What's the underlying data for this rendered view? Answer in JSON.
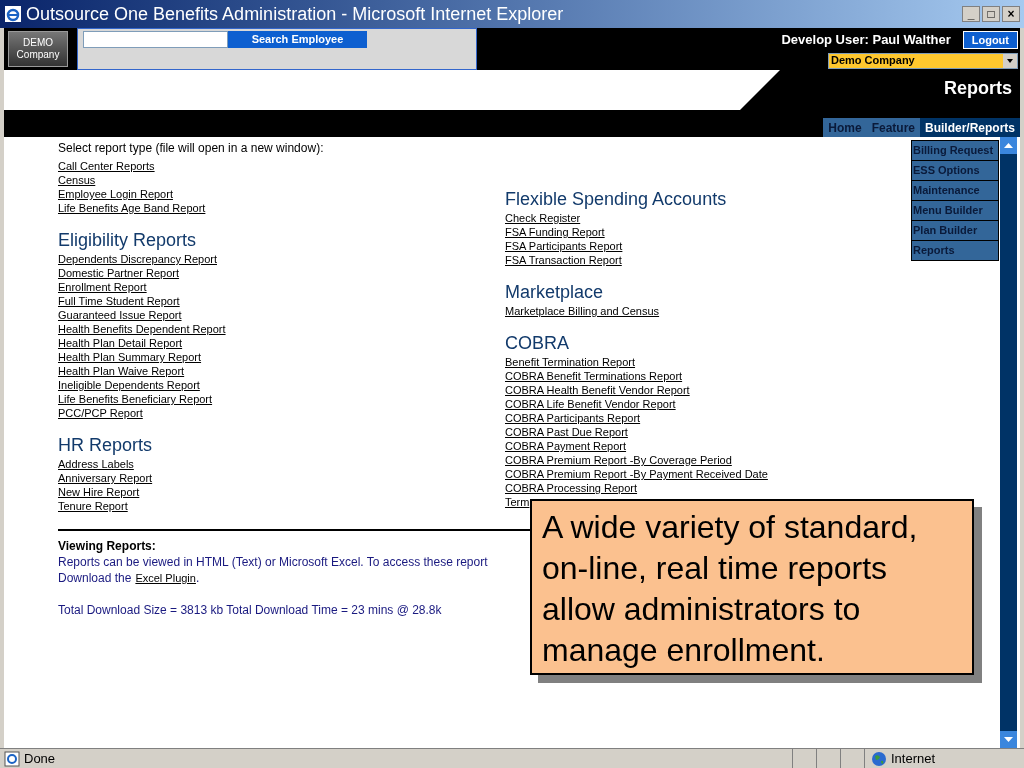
{
  "window": {
    "title": "Outsource One Benefits Administration - Microsoft Internet Explorer",
    "controls": [
      "_",
      "□",
      "×"
    ]
  },
  "header": {
    "logo": [
      "DEMO",
      "Company"
    ],
    "search_button": "Search Employee",
    "user": "Develop User: Paul Walther",
    "logout": "Logout",
    "company_select": "Demo Company",
    "page_title": "Reports"
  },
  "nav": {
    "tabs": [
      {
        "label": "Home",
        "selected": false
      },
      {
        "label": "Feature",
        "selected": false
      },
      {
        "label": "Builder/Reports",
        "selected": true
      }
    ],
    "menu": [
      "Billing Request",
      "ESS Options",
      "Maintenance",
      "Menu Builder",
      "Plan Builder",
      "Reports"
    ]
  },
  "intro": "Select report type (file will open in a new window):",
  "left_sections": [
    {
      "links": [
        "Call Center Reports",
        "Census",
        "Employee Login Report",
        "Life Benefits Age Band Report"
      ]
    },
    {
      "heading": "Eligibility Reports",
      "links": [
        "Dependents Discrepancy Report",
        "Domestic Partner Report",
        "Enrollment Report",
        "Full Time Student Report",
        "Guaranteed Issue Report",
        "Health Benefits Dependent Report",
        "Health Plan Detail Report",
        "Health Plan Summary Report",
        "Health Plan Waive Report",
        "Ineligible Dependents Report",
        "Life Benefits Beneficiary Report",
        "PCC/PCP Report"
      ]
    },
    {
      "heading": "HR Reports",
      "links": [
        "Address Labels",
        "Anniversary Report",
        "New Hire Report",
        "Tenure Report"
      ]
    }
  ],
  "right_sections": [
    {
      "heading": "Flexible Spending Accounts",
      "links": [
        "Check Register",
        "FSA Funding Report",
        "FSA Participants Report",
        "FSA Transaction Report"
      ]
    },
    {
      "heading": "Marketplace",
      "links": [
        "Marketplace Billing and Census"
      ]
    },
    {
      "heading": "COBRA",
      "links": [
        "Benefit Termination Report",
        "COBRA Benefit Terminations Report",
        "COBRA Health Benefit Vendor Report",
        "COBRA Life Benefit Vendor Report",
        "COBRA Participants Report",
        "COBRA Past Due Report",
        "COBRA Payment Report",
        "COBRA Premium Report -By Coverage Period",
        "COBRA Premium Report -By Payment Received Date",
        "COBRA Processing Report",
        "Term"
      ]
    }
  ],
  "viewing": {
    "heading": "Viewing Reports:",
    "text": "Reports can be viewed in HTML (Text) or Microsoft Excel. To access these report",
    "download_prefix": "Download the",
    "download_link": "Excel Plugin",
    "download_suffix": ".",
    "totals": "Total Download Size = 3813 kb Total Download Time = 23 mins @ 28.8k"
  },
  "callout": "A wide variety of standard, on-line, real time reports allow administrators to manage enrollment.",
  "status_bar": {
    "status": "Done",
    "zone": "Internet"
  }
}
